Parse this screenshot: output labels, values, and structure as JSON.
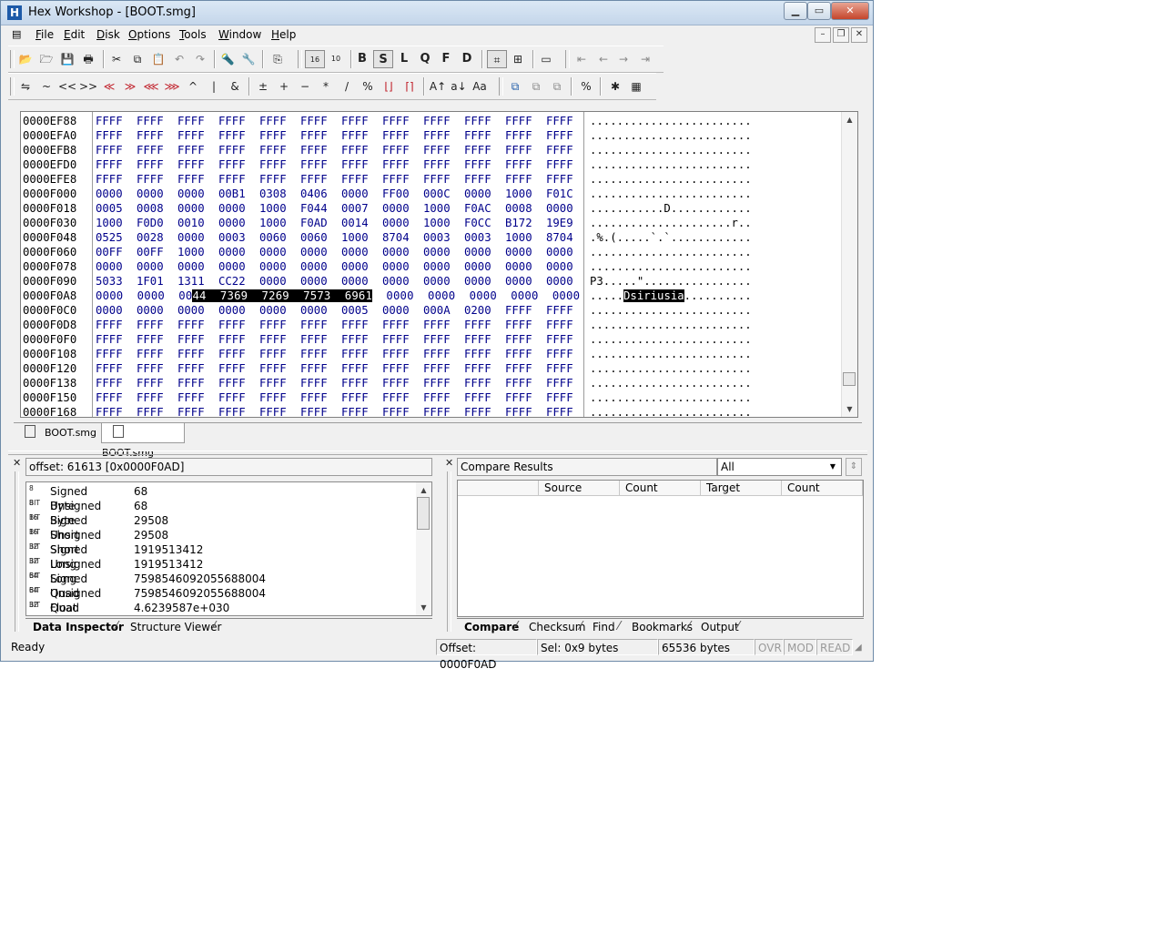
{
  "window": {
    "title": "Hex Workshop - [BOOT.smg]",
    "app_icon": "H"
  },
  "menu": [
    "File",
    "Edit",
    "Disk",
    "Options",
    "Tools",
    "Window",
    "Help"
  ],
  "toolbar1": {
    "format_buttons": [
      "B",
      "S",
      "L",
      "Q",
      "F",
      "D"
    ]
  },
  "toolbar2": {
    "ops": [
      "~",
      "<<",
      ">>",
      "&",
      "+",
      "−",
      "*",
      "/",
      "%"
    ]
  },
  "hex_rows": [
    {
      "addr": "0000EF88",
      "words": [
        "FFFF",
        "FFFF",
        "FFFF",
        "FFFF",
        "FFFF",
        "FFFF",
        "FFFF",
        "FFFF",
        "FFFF",
        "FFFF",
        "FFFF",
        "FFFF"
      ],
      "ascii": "........................"
    },
    {
      "addr": "0000EFA0",
      "words": [
        "FFFF",
        "FFFF",
        "FFFF",
        "FFFF",
        "FFFF",
        "FFFF",
        "FFFF",
        "FFFF",
        "FFFF",
        "FFFF",
        "FFFF",
        "FFFF"
      ],
      "ascii": "........................"
    },
    {
      "addr": "0000EFB8",
      "words": [
        "FFFF",
        "FFFF",
        "FFFF",
        "FFFF",
        "FFFF",
        "FFFF",
        "FFFF",
        "FFFF",
        "FFFF",
        "FFFF",
        "FFFF",
        "FFFF"
      ],
      "ascii": "........................"
    },
    {
      "addr": "0000EFD0",
      "words": [
        "FFFF",
        "FFFF",
        "FFFF",
        "FFFF",
        "FFFF",
        "FFFF",
        "FFFF",
        "FFFF",
        "FFFF",
        "FFFF",
        "FFFF",
        "FFFF"
      ],
      "ascii": "........................"
    },
    {
      "addr": "0000EFE8",
      "words": [
        "FFFF",
        "FFFF",
        "FFFF",
        "FFFF",
        "FFFF",
        "FFFF",
        "FFFF",
        "FFFF",
        "FFFF",
        "FFFF",
        "FFFF",
        "FFFF"
      ],
      "ascii": "........................"
    },
    {
      "addr": "0000F000",
      "words": [
        "0000",
        "0000",
        "0000",
        "00B1",
        "0308",
        "0406",
        "0000",
        "FF00",
        "000C",
        "0000",
        "1000",
        "F01C"
      ],
      "ascii": "........................"
    },
    {
      "addr": "0000F018",
      "words": [
        "0005",
        "0008",
        "0000",
        "0000",
        "1000",
        "F044",
        "0007",
        "0000",
        "1000",
        "F0AC",
        "0008",
        "0000"
      ],
      "ascii": "...........D............"
    },
    {
      "addr": "0000F030",
      "words": [
        "1000",
        "F0D0",
        "0010",
        "0000",
        "1000",
        "F0AD",
        "0014",
        "0000",
        "1000",
        "F0CC",
        "B172",
        "19E9"
      ],
      "ascii": ".....................r.."
    },
    {
      "addr": "0000F048",
      "words": [
        "0525",
        "0028",
        "0000",
        "0003",
        "0060",
        "0060",
        "1000",
        "8704",
        "0003",
        "0003",
        "1000",
        "8704"
      ],
      "ascii": ".%.(.....`.`............"
    },
    {
      "addr": "0000F060",
      "words": [
        "00FF",
        "00FF",
        "1000",
        "0000",
        "0000",
        "0000",
        "0000",
        "0000",
        "0000",
        "0000",
        "0000",
        "0000"
      ],
      "ascii": "........................"
    },
    {
      "addr": "0000F078",
      "words": [
        "0000",
        "0000",
        "0000",
        "0000",
        "0000",
        "0000",
        "0000",
        "0000",
        "0000",
        "0000",
        "0000",
        "0000"
      ],
      "ascii": "........................"
    },
    {
      "addr": "0000F090",
      "words": [
        "5033",
        "1F01",
        "1311",
        "CC22",
        "0000",
        "0000",
        "0000",
        "0000",
        "0000",
        "0000",
        "0000",
        "0000"
      ],
      "ascii": "P3.....\"................"
    },
    {
      "addr": "0000F0A8",
      "words": [
        "0000",
        "0000",
        "0044",
        "7369",
        "7269",
        "7573",
        "6961",
        "0000",
        "0000",
        "0000",
        "0000",
        "0000"
      ],
      "ascii": "........................"
    },
    {
      "addr": "0000F0C0",
      "words": [
        "0000",
        "0000",
        "0000",
        "0000",
        "0000",
        "0000",
        "0005",
        "0000",
        "000A",
        "0200",
        "FFFF",
        "FFFF"
      ],
      "ascii": "........................"
    },
    {
      "addr": "0000F0D8",
      "words": [
        "FFFF",
        "FFFF",
        "FFFF",
        "FFFF",
        "FFFF",
        "FFFF",
        "FFFF",
        "FFFF",
        "FFFF",
        "FFFF",
        "FFFF",
        "FFFF"
      ],
      "ascii": "........................"
    },
    {
      "addr": "0000F0F0",
      "words": [
        "FFFF",
        "FFFF",
        "FFFF",
        "FFFF",
        "FFFF",
        "FFFF",
        "FFFF",
        "FFFF",
        "FFFF",
        "FFFF",
        "FFFF",
        "FFFF"
      ],
      "ascii": "........................"
    },
    {
      "addr": "0000F108",
      "words": [
        "FFFF",
        "FFFF",
        "FFFF",
        "FFFF",
        "FFFF",
        "FFFF",
        "FFFF",
        "FFFF",
        "FFFF",
        "FFFF",
        "FFFF",
        "FFFF"
      ],
      "ascii": "........................"
    },
    {
      "addr": "0000F120",
      "words": [
        "FFFF",
        "FFFF",
        "FFFF",
        "FFFF",
        "FFFF",
        "FFFF",
        "FFFF",
        "FFFF",
        "FFFF",
        "FFFF",
        "FFFF",
        "FFFF"
      ],
      "ascii": "........................"
    },
    {
      "addr": "0000F138",
      "words": [
        "FFFF",
        "FFFF",
        "FFFF",
        "FFFF",
        "FFFF",
        "FFFF",
        "FFFF",
        "FFFF",
        "FFFF",
        "FFFF",
        "FFFF",
        "FFFF"
      ],
      "ascii": "........................"
    },
    {
      "addr": "0000F150",
      "words": [
        "FFFF",
        "FFFF",
        "FFFF",
        "FFFF",
        "FFFF",
        "FFFF",
        "FFFF",
        "FFFF",
        "FFFF",
        "FFFF",
        "FFFF",
        "FFFF"
      ],
      "ascii": "........................"
    },
    {
      "addr": "0000F168",
      "words": [
        "FFFF",
        "FFFF",
        "FFFF",
        "FFFF",
        "FFFF",
        "FFFF",
        "FFFF",
        "FFFF",
        "FFFF",
        "FFFF",
        "FFFF",
        "FFFF"
      ],
      "ascii": "........................"
    }
  ],
  "selection": {
    "row_index": 12,
    "hex_prefix": "0000  0000  00",
    "hex_selected": "44  7369  7269  7573  6961",
    "hex_suffix": "  0000  0000  0000  0000  0000",
    "ascii_prefix": ".....",
    "ascii_selected": "Dsiriusia",
    "ascii_suffix": ".........."
  },
  "doc_tabs": [
    "BOOT.smg",
    "BOOT.smg"
  ],
  "inspector": {
    "offset_label": "offset: 61613 [0x0000F0AD]",
    "rows": [
      {
        "bits": "8 BIT",
        "name": "Signed Byte",
        "value": "68"
      },
      {
        "bits": "8 BIT",
        "name": "Unsigned Byte",
        "value": "68"
      },
      {
        "bits": "16 BIT",
        "name": "Signed Short",
        "value": "29508"
      },
      {
        "bits": "16 BIT",
        "name": "Unsigned Short",
        "value": "29508"
      },
      {
        "bits": "32 BIT",
        "name": "Signed Long",
        "value": "1919513412"
      },
      {
        "bits": "32 BIT",
        "name": "Unsigned Long",
        "value": "1919513412"
      },
      {
        "bits": "64 BIT",
        "name": "Signed Quad",
        "value": "7598546092055688004"
      },
      {
        "bits": "64 BIT",
        "name": "Unsigned Quad",
        "value": "7598546092055688004"
      },
      {
        "bits": "32 BIT",
        "name": "Float",
        "value": "4.6239587e+030"
      }
    ],
    "tabs": [
      "Data Inspector",
      "Structure Viewer"
    ]
  },
  "compare": {
    "title": "Compare Results",
    "filter": "All",
    "columns": [
      "",
      "Source",
      "Count",
      "Target",
      "Count"
    ],
    "tabs": [
      "Compare",
      "Checksum",
      "Find",
      "Bookmarks",
      "Output"
    ]
  },
  "status": {
    "ready": "Ready",
    "offset": "Offset: 0000F0AD",
    "sel": "Sel: 0x9 bytes",
    "size": "65536 bytes",
    "ovr": "OVR",
    "mod": "MOD",
    "read": "READ"
  },
  "colors": {
    "hex_text": "#00008b",
    "selection_bg": "#000000"
  }
}
